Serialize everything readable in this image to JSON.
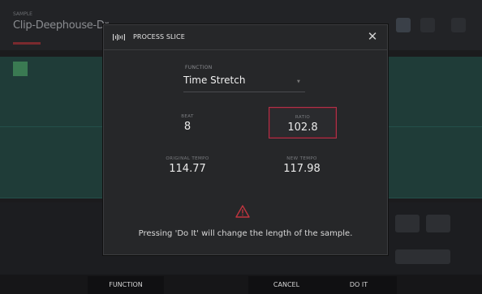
{
  "background": {
    "title": "Clip-Deephouse-Dr",
    "subtitle": "SAMPLE"
  },
  "dialog": {
    "title": "PROCESS SLICE",
    "function_label": "FUNCTION",
    "function_value": "Time Stretch",
    "params": [
      {
        "label": "BEAT",
        "value": "8"
      },
      {
        "label": "RATIO",
        "value": "102.8"
      },
      {
        "label": "ORIGINAL TEMPO",
        "value": "114.77"
      },
      {
        "label": "NEW TEMPO",
        "value": "117.98"
      }
    ],
    "warning": "Pressing 'Do It' will change the length of the sample."
  },
  "softkeys": {
    "function": "FUNCTION",
    "cancel": "CANCEL",
    "do_it": "DO IT"
  },
  "colors": {
    "accent": "#b0334a",
    "warning": "#c0353f",
    "waveform_bg": "#1f3c38"
  }
}
